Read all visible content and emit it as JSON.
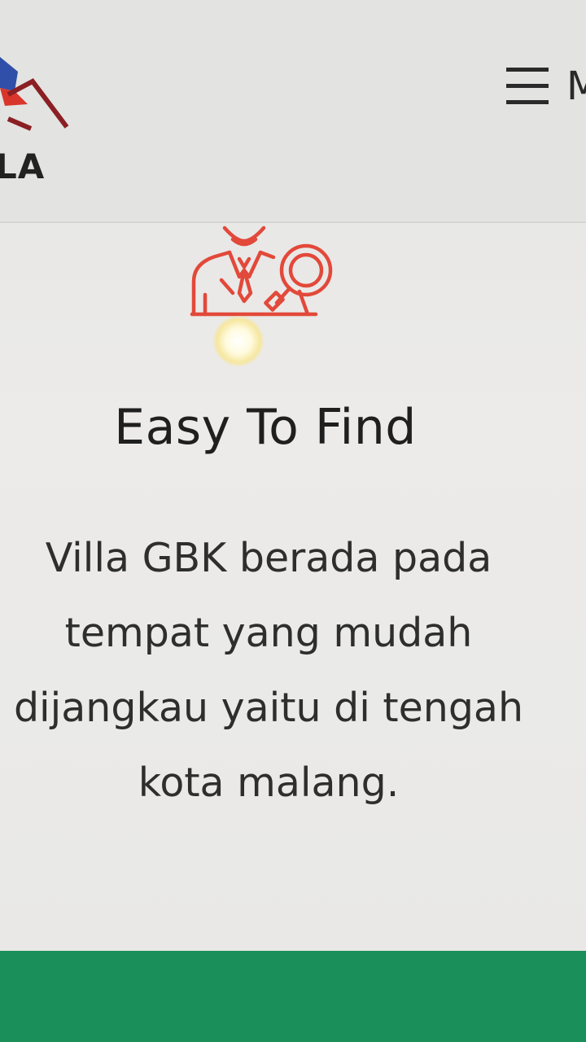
{
  "header": {
    "logo_text": "LA",
    "menu_label": "M"
  },
  "feature": {
    "icon": "search-person-icon",
    "title": "Easy To Find",
    "description": "Villa GBK berada pada tempat yang mudah dijangkau yaitu di tengah kota malang."
  },
  "colors": {
    "accent": "#e2493a",
    "footer": "#1b8f5a",
    "text": "#1f1f1f"
  }
}
